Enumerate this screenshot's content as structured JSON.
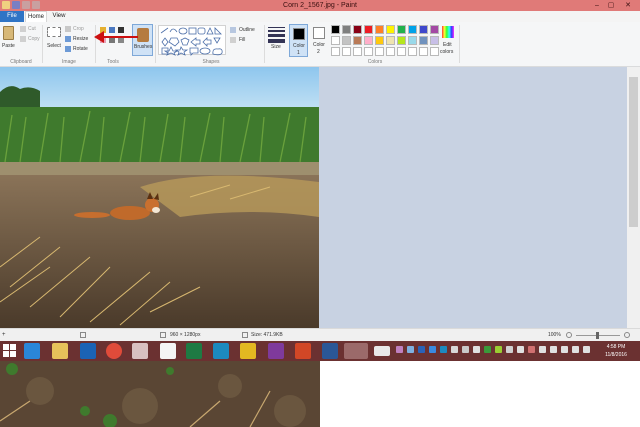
{
  "window": {
    "title": "Corn 2_1567.jpg - Paint",
    "minimize": "–",
    "maximize": "▢",
    "close": "✕"
  },
  "tabs": {
    "file": "File",
    "home": "Home",
    "view": "View"
  },
  "ribbon": {
    "clipboard": {
      "paste": "Paste",
      "cut": "Cut",
      "copy": "Copy",
      "group": "Clipboard"
    },
    "image": {
      "select": "Select",
      "crop": "Crop",
      "resize": "Resize",
      "rotate": "Rotate",
      "group": "Image"
    },
    "tools": {
      "group": "Tools"
    },
    "brushes": "Brushes",
    "shapes": {
      "outline": "Outline",
      "fill": "Fill",
      "group": "Shapes"
    },
    "size": "Size",
    "color1": "Color\n1",
    "color1_a": "Color",
    "color1_b": "1",
    "color2_a": "Color",
    "color2_b": "2",
    "colors_group": "Colors",
    "edit_colors_a": "Edit",
    "edit_colors_b": "colors"
  },
  "palette": [
    [
      "#000000",
      "#7f7f7f",
      "#880015",
      "#ed1c24",
      "#ff7f27",
      "#fff200",
      "#22b14c",
      "#00a2e8",
      "#3f48cc",
      "#a349a4"
    ],
    [
      "#ffffff",
      "#c3c3c3",
      "#b97a57",
      "#ffaec9",
      "#ffc90e",
      "#efe4b0",
      "#b5e61d",
      "#99d9ea",
      "#7092be",
      "#c8bfe7"
    ],
    [
      "#ffffff",
      "#ffffff",
      "#ffffff",
      "#ffffff",
      "#ffffff",
      "#ffffff",
      "#ffffff",
      "#ffffff",
      "#ffffff",
      "#ffffff"
    ]
  ],
  "status": {
    "dimensions": "960 × 1280px",
    "size": "Size: 471.9KB",
    "zoom": "100%"
  },
  "clock": {
    "time": "4:58 PM",
    "date": "11/8/2016"
  },
  "colors": {
    "titlebar": "#e07a78",
    "taskbar": "#6b3131",
    "canvas_bg": "#c8d2e2"
  }
}
